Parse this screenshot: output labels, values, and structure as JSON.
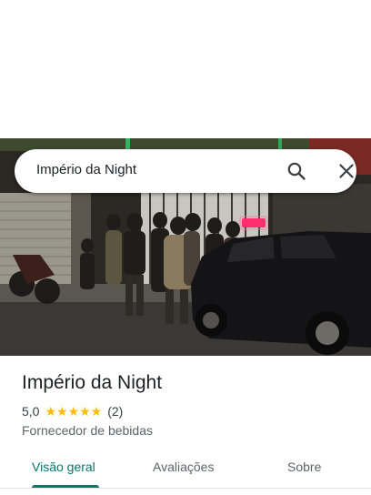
{
  "search": {
    "query": "Império da Night"
  },
  "icons": {
    "search": "search-icon",
    "close": "close-icon",
    "star": "star-icon"
  },
  "place": {
    "name": "Império da Night",
    "rating": "5,0",
    "stars": "★★★★★",
    "review_count": "(2)",
    "category": "Fornecedor de bebidas"
  },
  "tabs": [
    {
      "label": "Visão geral",
      "active": true
    },
    {
      "label": "Avaliações",
      "active": false
    },
    {
      "label": "Sobre",
      "active": false
    }
  ],
  "colors": {
    "accent": "#00796b",
    "star": "#fbbc04"
  }
}
